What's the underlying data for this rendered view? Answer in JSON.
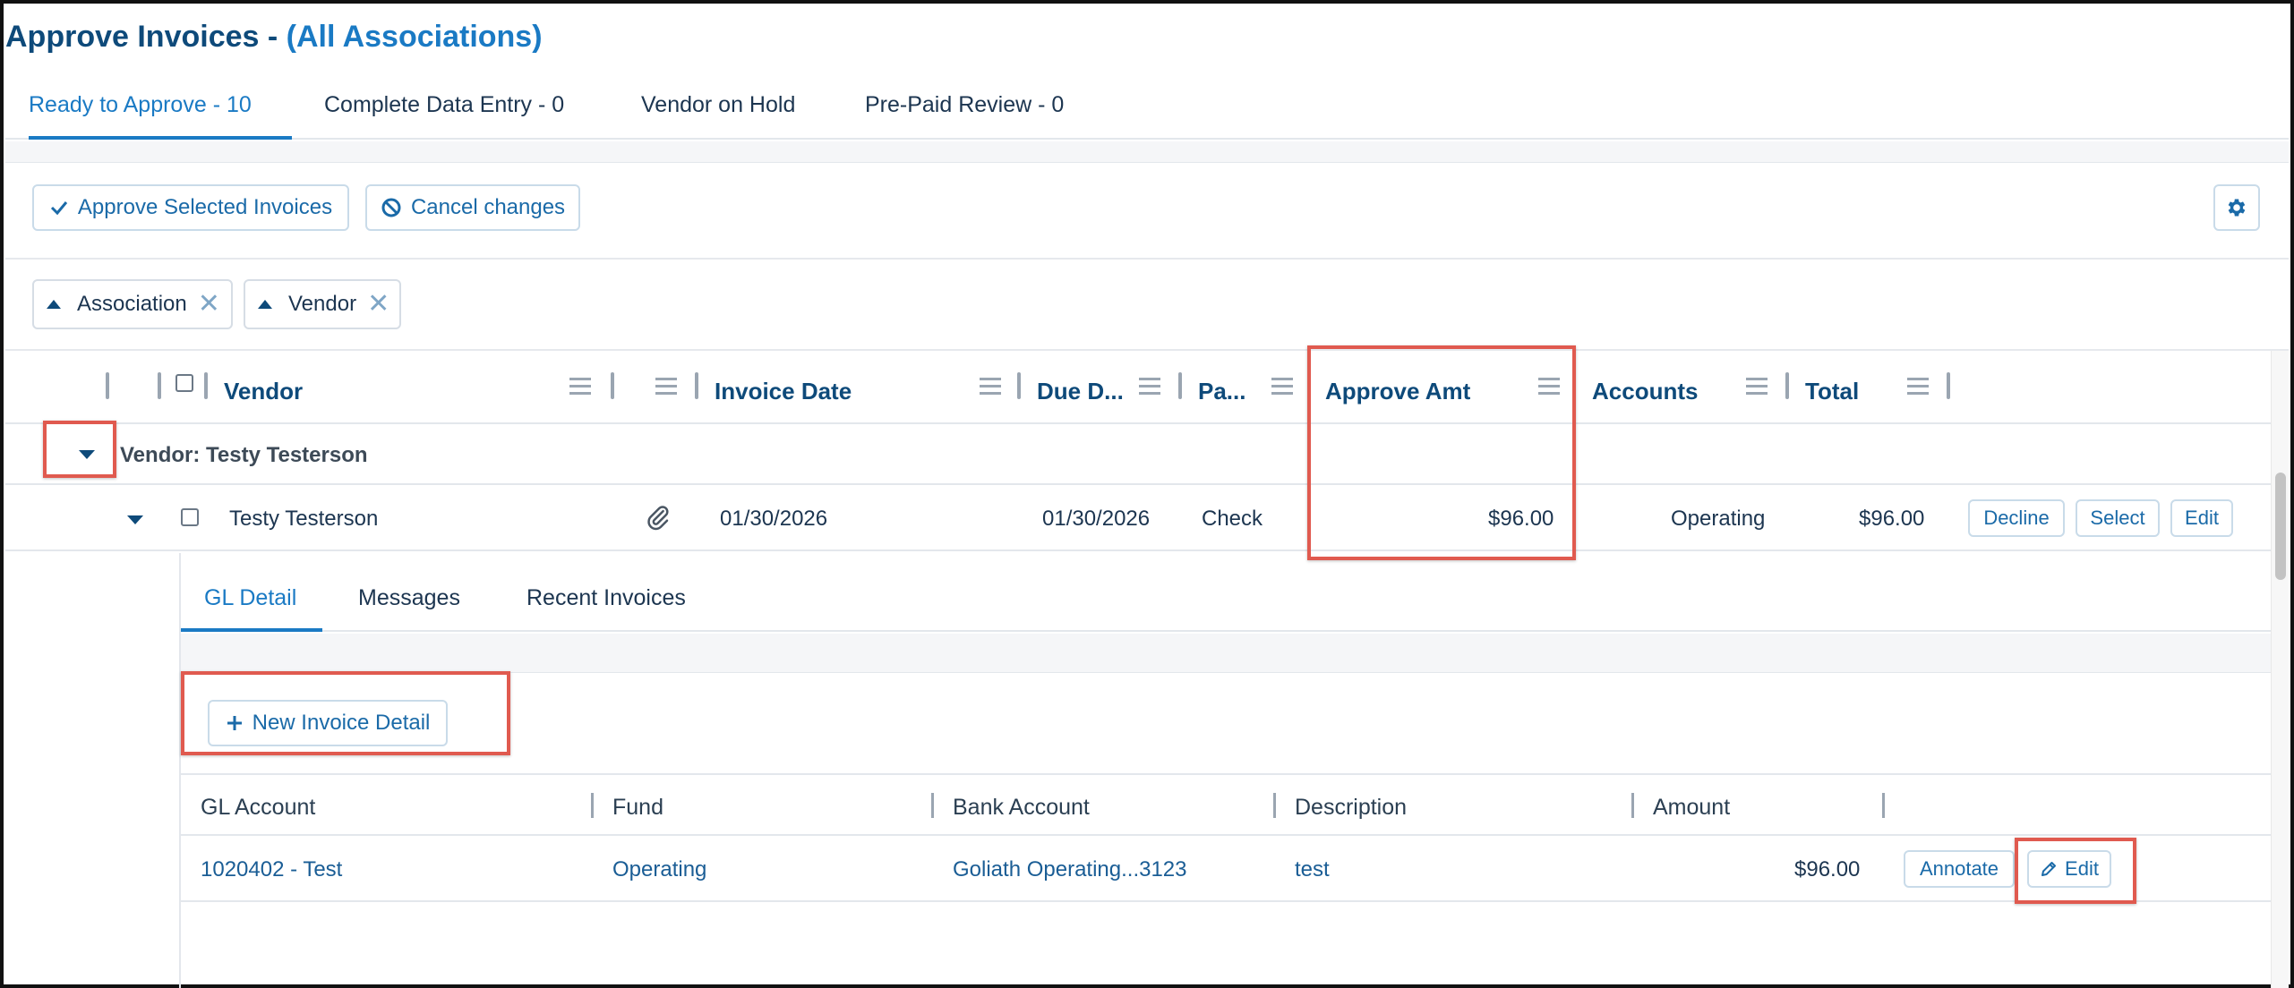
{
  "page": {
    "title": "Approve Invoices - ",
    "title_scope": "(All Associations)"
  },
  "top_tabs": [
    {
      "label": "Ready to Approve - 10",
      "active": true
    },
    {
      "label": "Complete Data Entry - 0",
      "active": false
    },
    {
      "label": "Vendor on Hold",
      "active": false
    },
    {
      "label": "Pre-Paid Review - 0",
      "active": false
    }
  ],
  "toolbar": {
    "approve_label": "Approve Selected Invoices",
    "cancel_label": "Cancel changes",
    "settings_icon": "gear-icon"
  },
  "grouping": {
    "chips": [
      {
        "label": "Association",
        "icon": "sort-up-icon",
        "remove_icon": "close-icon"
      },
      {
        "label": "Vendor",
        "icon": "sort-up-icon",
        "remove_icon": "close-icon"
      }
    ]
  },
  "grid": {
    "columns": [
      "Vendor",
      "Invoice Date",
      "Due D...",
      "Pa...",
      "Approve Amt",
      "Accounts",
      "Total"
    ],
    "group_label": "Vendor: Testy Testerson",
    "row": {
      "vendor": "Testy Testerson",
      "attachment_icon": "paperclip-icon",
      "invoice_date": "01/30/2026",
      "due_date": "01/30/2026",
      "payment": "Check",
      "approve_amt": "$96.00",
      "accounts": "Operating",
      "total": "$96.00",
      "actions": [
        "Decline",
        "Select",
        "Edit"
      ]
    }
  },
  "detail": {
    "tabs": [
      {
        "label": "GL Detail",
        "active": true
      },
      {
        "label": "Messages",
        "active": false
      },
      {
        "label": "Recent Invoices",
        "active": false
      }
    ],
    "new_detail_label": "New Invoice Detail",
    "gl_columns": [
      "GL Account",
      "Fund",
      "Bank Account",
      "Description",
      "Amount"
    ],
    "gl_row": {
      "gl_account": "1020402 - Test",
      "fund": "Operating",
      "bank_account": "Goliath Operating...3123",
      "description": "test",
      "amount": "$96.00",
      "annotate_label": "Annotate",
      "edit_label": "Edit"
    }
  },
  "colors": {
    "accent": "#1a7ac4",
    "heading": "#0e4a7a",
    "highlight": "#e05a4f"
  }
}
